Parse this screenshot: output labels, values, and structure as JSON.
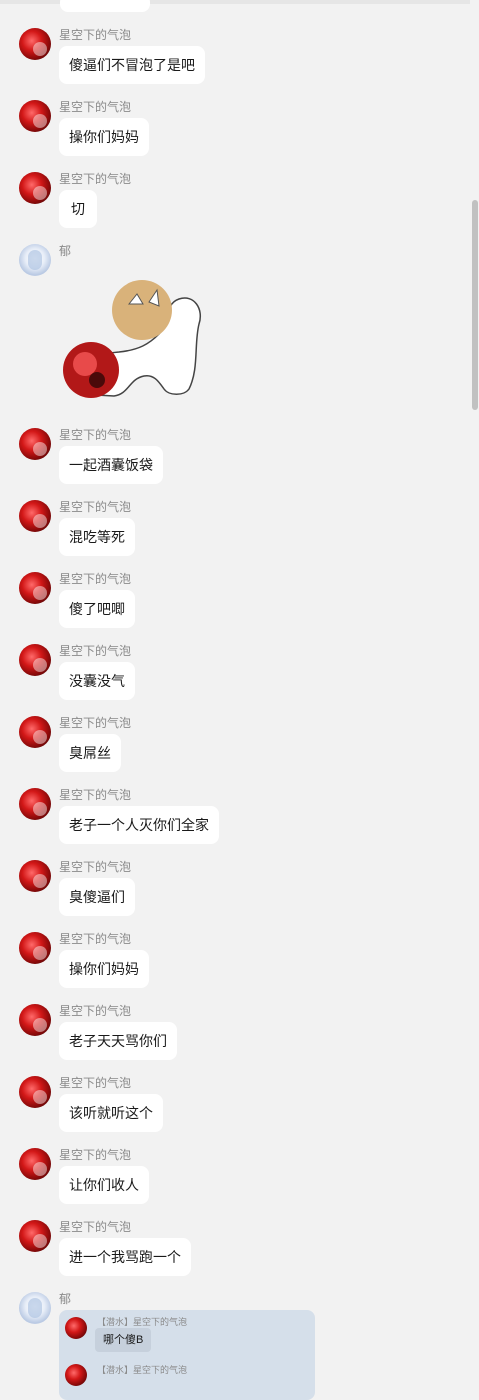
{
  "sender_main": "星空下的气泡",
  "sender_other": "郁",
  "messages": [
    "傻逼们不冒泡了是吧",
    "操你们妈妈",
    "切",
    "一起酒囊饭袋",
    "混吃等死",
    "傻了吧唧",
    "没囊没气",
    "臭屌丝",
    "老子一个人灭你们全家",
    "臭傻逼们",
    "操你们妈妈",
    "老子天天骂你们",
    "该听就听这个",
    "让你们收人",
    "进一个我骂跑一个"
  ],
  "quote": {
    "items": [
      {
        "sender": "【潜水】星空下的气泡",
        "text": "哪个傻B"
      },
      {
        "sender": "【潜水】星空下的气泡",
        "text": ""
      }
    ]
  },
  "colors": {
    "background": "#f2f2f2",
    "bubble": "#ffffff",
    "quote_card": "#d5dfea",
    "sender_text": "#8a8a8a"
  },
  "icons": {
    "main_avatar": "red-anime-avatar",
    "other_avatar": "light-blue-anime-avatar",
    "sticker": "cat-pushing-ball-sticker"
  }
}
